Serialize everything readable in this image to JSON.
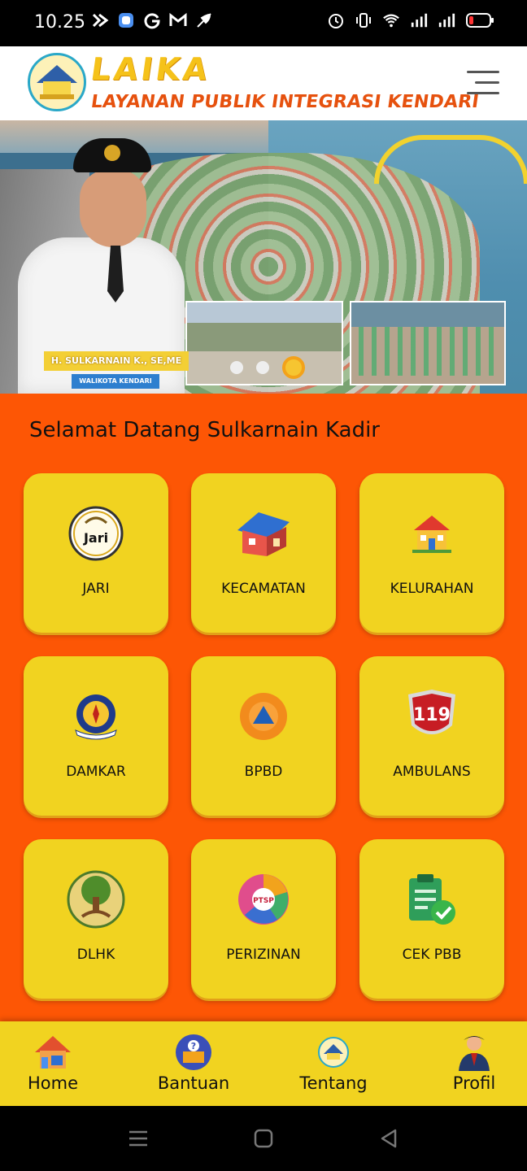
{
  "status_bar": {
    "time": "10.25",
    "icons_left": [
      "kuik-icon",
      "app-icon",
      "g-icon",
      "gmail-icon",
      "feather-icon"
    ],
    "icons_right": [
      "alarm-icon",
      "vibrate-icon",
      "wifi-icon",
      "signal-icon",
      "signal-icon",
      "battery-icon"
    ]
  },
  "header": {
    "app_name": "LAIKA",
    "subtitle": "LAYANAN PUBLIK INTEGRASI KENDARI",
    "logo_badge_text": "Laika",
    "menu_icon": "hamburger-menu-icon"
  },
  "banner": {
    "plate_name": "H. SULKARNAIN K., SE,ME",
    "plate_role": "WALIKOTA KENDARI",
    "slides_total": 3,
    "active_slide": 3
  },
  "main": {
    "welcome_text": "Selamat Datang Sulkarnain Kadir",
    "menu_items": [
      {
        "label": "JARI",
        "icon": "jari-logo-icon"
      },
      {
        "label": "KECAMATAN",
        "icon": "house-icon"
      },
      {
        "label": "KELURAHAN",
        "icon": "village-office-icon"
      },
      {
        "label": "DAMKAR",
        "icon": "damkar-emblem-icon"
      },
      {
        "label": "BPBD",
        "icon": "bpbd-emblem-icon"
      },
      {
        "label": "AMBULANS",
        "icon": "ambulans-119-shield-icon"
      },
      {
        "label": "DLHK",
        "icon": "tree-emblem-icon"
      },
      {
        "label": "PERIZINAN",
        "icon": "ptsp-emblem-icon"
      },
      {
        "label": "CEK PBB",
        "icon": "clipboard-check-icon"
      }
    ]
  },
  "bottom_nav": {
    "items": [
      {
        "label": "Home",
        "icon": "home-icon"
      },
      {
        "label": "Bantuan",
        "icon": "help-icon"
      },
      {
        "label": "Tentang",
        "icon": "laika-logo-icon"
      },
      {
        "label": "Profil",
        "icon": "profile-icon"
      }
    ]
  },
  "icon_texts": {
    "jari": "Jari",
    "ambulans_number": "119",
    "ptsp": "PTSP"
  },
  "colors": {
    "accent_orange": "#fd5605",
    "card_yellow": "#f1d320",
    "logo_yellow": "#f5c21a",
    "subtitle_orange": "#e6510e"
  }
}
